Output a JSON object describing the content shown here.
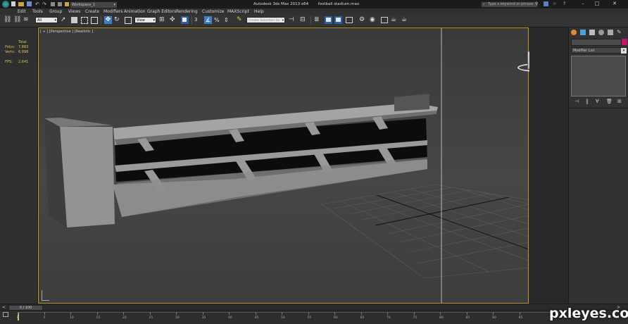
{
  "titlebar": {
    "workspace": "Workspace_1",
    "app_title": "Autodesk 3ds Max  2013 x64",
    "file_name": "football stadium.max",
    "search_placeholder": "Type a keyword or phrase"
  },
  "menu": [
    "Edit",
    "Tools",
    "Group",
    "Views",
    "Create",
    "Modifiers",
    "Animation",
    "Graph Editors",
    "Rendering",
    "Customize",
    "MAXScript",
    "Help"
  ],
  "toolbar": {
    "selection_filter": "All",
    "ref_coord": "View",
    "named_selection_placeholder": "Create Selection Se"
  },
  "viewport": {
    "label": "[ + ] [Perspective ] [Realistic ]",
    "stats": {
      "header": "Total",
      "polys_label": "Polys:",
      "polys_value": "7,883",
      "verts_label": "Verts:",
      "verts_value": "6,998",
      "fps_label": "FPS:",
      "fps_value": "2,641"
    }
  },
  "command_panel": {
    "modifier_list_label": "Modifier List"
  },
  "timeslider": {
    "frame_label": "0 / 100"
  },
  "trackbar": {
    "ticks": [
      "0",
      "5",
      "10",
      "15",
      "20",
      "25",
      "30",
      "35",
      "40",
      "45",
      "50",
      "55",
      "60",
      "65",
      "70",
      "75",
      "80",
      "85",
      "90",
      "95"
    ]
  },
  "watermark": "pxleyes.com",
  "colors": {
    "viewport_border": "#b89a24",
    "stats_text": "#d6c35a",
    "color_swatch": "#c2186a"
  }
}
